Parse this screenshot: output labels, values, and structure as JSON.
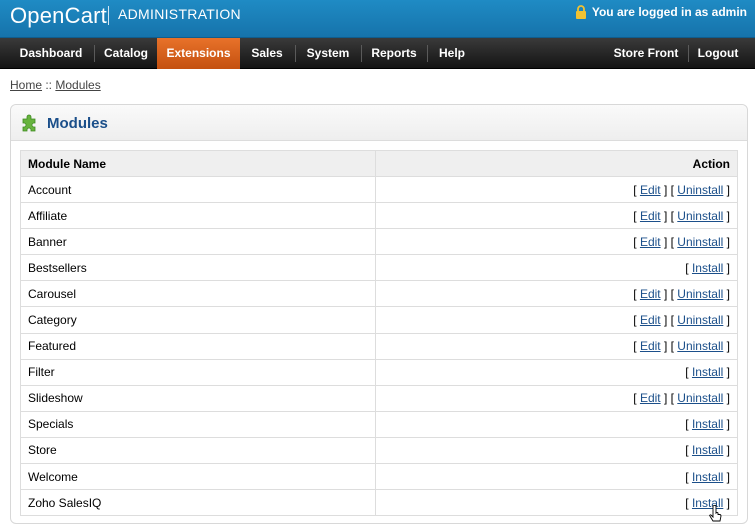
{
  "header": {
    "brand": "OpenCart",
    "subtitle": "ADMINISTRATION",
    "logged_in": "You are logged in as admin"
  },
  "menu": {
    "items": [
      "Dashboard",
      "Catalog",
      "Extensions",
      "Sales",
      "System",
      "Reports",
      "Help"
    ],
    "right_items": [
      "Store Front",
      "Logout"
    ],
    "active": "Extensions"
  },
  "breadcrumb": {
    "home": "Home",
    "sep": " :: ",
    "current": "Modules"
  },
  "box": {
    "title": "Modules"
  },
  "table": {
    "headers": [
      "Module Name",
      "Action"
    ],
    "rows": [
      {
        "name": "Account",
        "installed": true
      },
      {
        "name": "Affiliate",
        "installed": true
      },
      {
        "name": "Banner",
        "installed": true
      },
      {
        "name": "Bestsellers",
        "installed": false
      },
      {
        "name": "Carousel",
        "installed": true
      },
      {
        "name": "Category",
        "installed": true
      },
      {
        "name": "Featured",
        "installed": true
      },
      {
        "name": "Filter",
        "installed": false
      },
      {
        "name": "Slideshow",
        "installed": true
      },
      {
        "name": "Specials",
        "installed": false
      },
      {
        "name": "Store",
        "installed": false
      },
      {
        "name": "Welcome",
        "installed": false
      },
      {
        "name": "Zoho SalesIQ",
        "installed": false
      }
    ],
    "labels": {
      "edit": "Edit",
      "uninstall": "Uninstall",
      "install": "Install",
      "open": "[ ",
      "close": " ]",
      "mid": " ] [ "
    }
  },
  "colors": {
    "header": "#1a80b8",
    "menu": "#222222",
    "active_tab": "#d7611d",
    "link": "#1b4f8a"
  }
}
